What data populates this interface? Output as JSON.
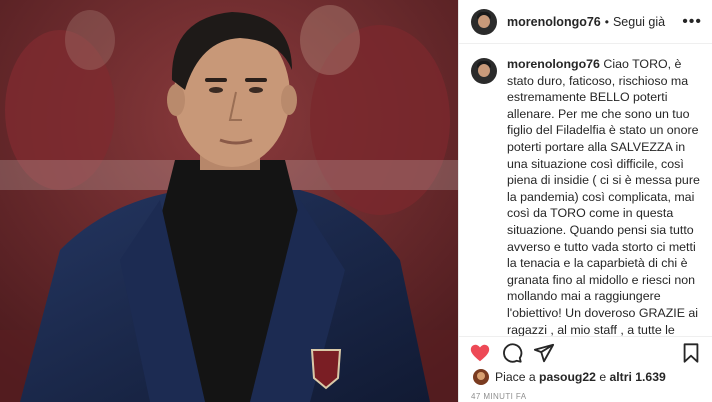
{
  "header": {
    "username": "morenolongo76",
    "separator": "•",
    "follow_label": "Segui già",
    "more_label": "•••"
  },
  "caption": {
    "username": "morenolongo76",
    "text": "Ciao TORO, è stato duro, faticoso, rischioso ma estremamente BELLO poterti allenare. Per me che sono un tuo figlio del Filadelfia è stato un onore poterti portare alla SALVEZZA in una situazione così difficile, così piena di insidie ( ci si è messa pure la pandemia) così complicata, mai così da TORO come in questa situazione. Quando pensi sia tutto avverso e tutto vada storto ci metti la tenacia e la caparbietà di chi è granata fino al midollo e riesci non mollando mai a raggiungere l'obiettivo! Un doveroso GRAZIE ai ragazzi , al mio staff , a tutte le persone che hanno lavorato con me e a tutti i TIFOSI che mi hanno sostenuto e incitato dal primo giorno"
  },
  "actions": {
    "like_icon": "heart-filled-icon",
    "comment_icon": "comment-icon",
    "share_icon": "share-icon",
    "save_icon": "bookmark-icon",
    "like_color": "#ed4956"
  },
  "likes": {
    "prefix": "Piace a",
    "user": "pasoug22",
    "middle": "e",
    "others": "altri 1.639"
  },
  "timestamp": "47 minuti fa"
}
